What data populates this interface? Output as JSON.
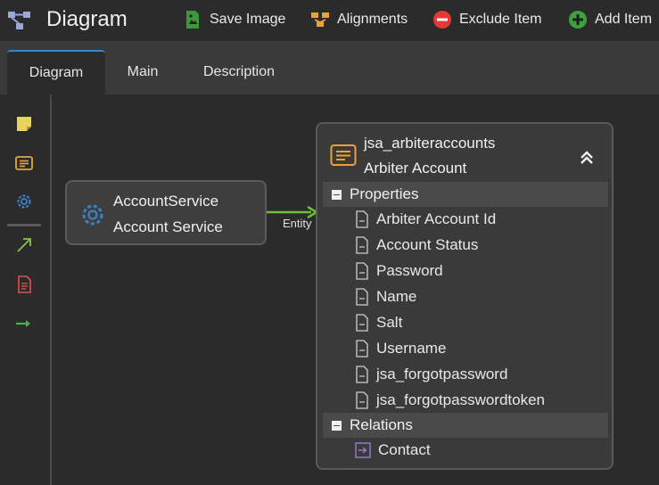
{
  "app": {
    "title": "Diagram"
  },
  "toolbar": {
    "save_image": "Save Image",
    "alignments": "Alignments",
    "exclude_item": "Exclude Item",
    "add_item": "Add Item"
  },
  "tabs": [
    {
      "label": "Diagram",
      "active": true
    },
    {
      "label": "Main",
      "active": false
    },
    {
      "label": "Description",
      "active": false
    }
  ],
  "palette": {
    "items": [
      "sticky-note-icon",
      "entity-icon",
      "service-gear-icon",
      "arrow-diagonal-icon",
      "document-icon",
      "arrow-right-icon"
    ]
  },
  "diagram": {
    "service": {
      "name": "AccountService",
      "label": "Account Service"
    },
    "connector": {
      "label": "Entity"
    },
    "entity": {
      "name": "jsa_arbiteraccounts",
      "label": "Arbiter Account",
      "properties_header": "Properties",
      "properties": [
        "Arbiter Account Id",
        "Account Status",
        "Password",
        "Name",
        "Salt",
        "Username",
        "jsa_forgotpassword",
        "jsa_forgotpasswordtoken"
      ],
      "relations_header": "Relations",
      "relations": [
        "Contact"
      ]
    }
  },
  "colors": {
    "accent_blue": "#3b82c4",
    "green": "#4caf50",
    "orange": "#e8a33a",
    "red": "#e53935",
    "yellow": "#e6d35a"
  }
}
